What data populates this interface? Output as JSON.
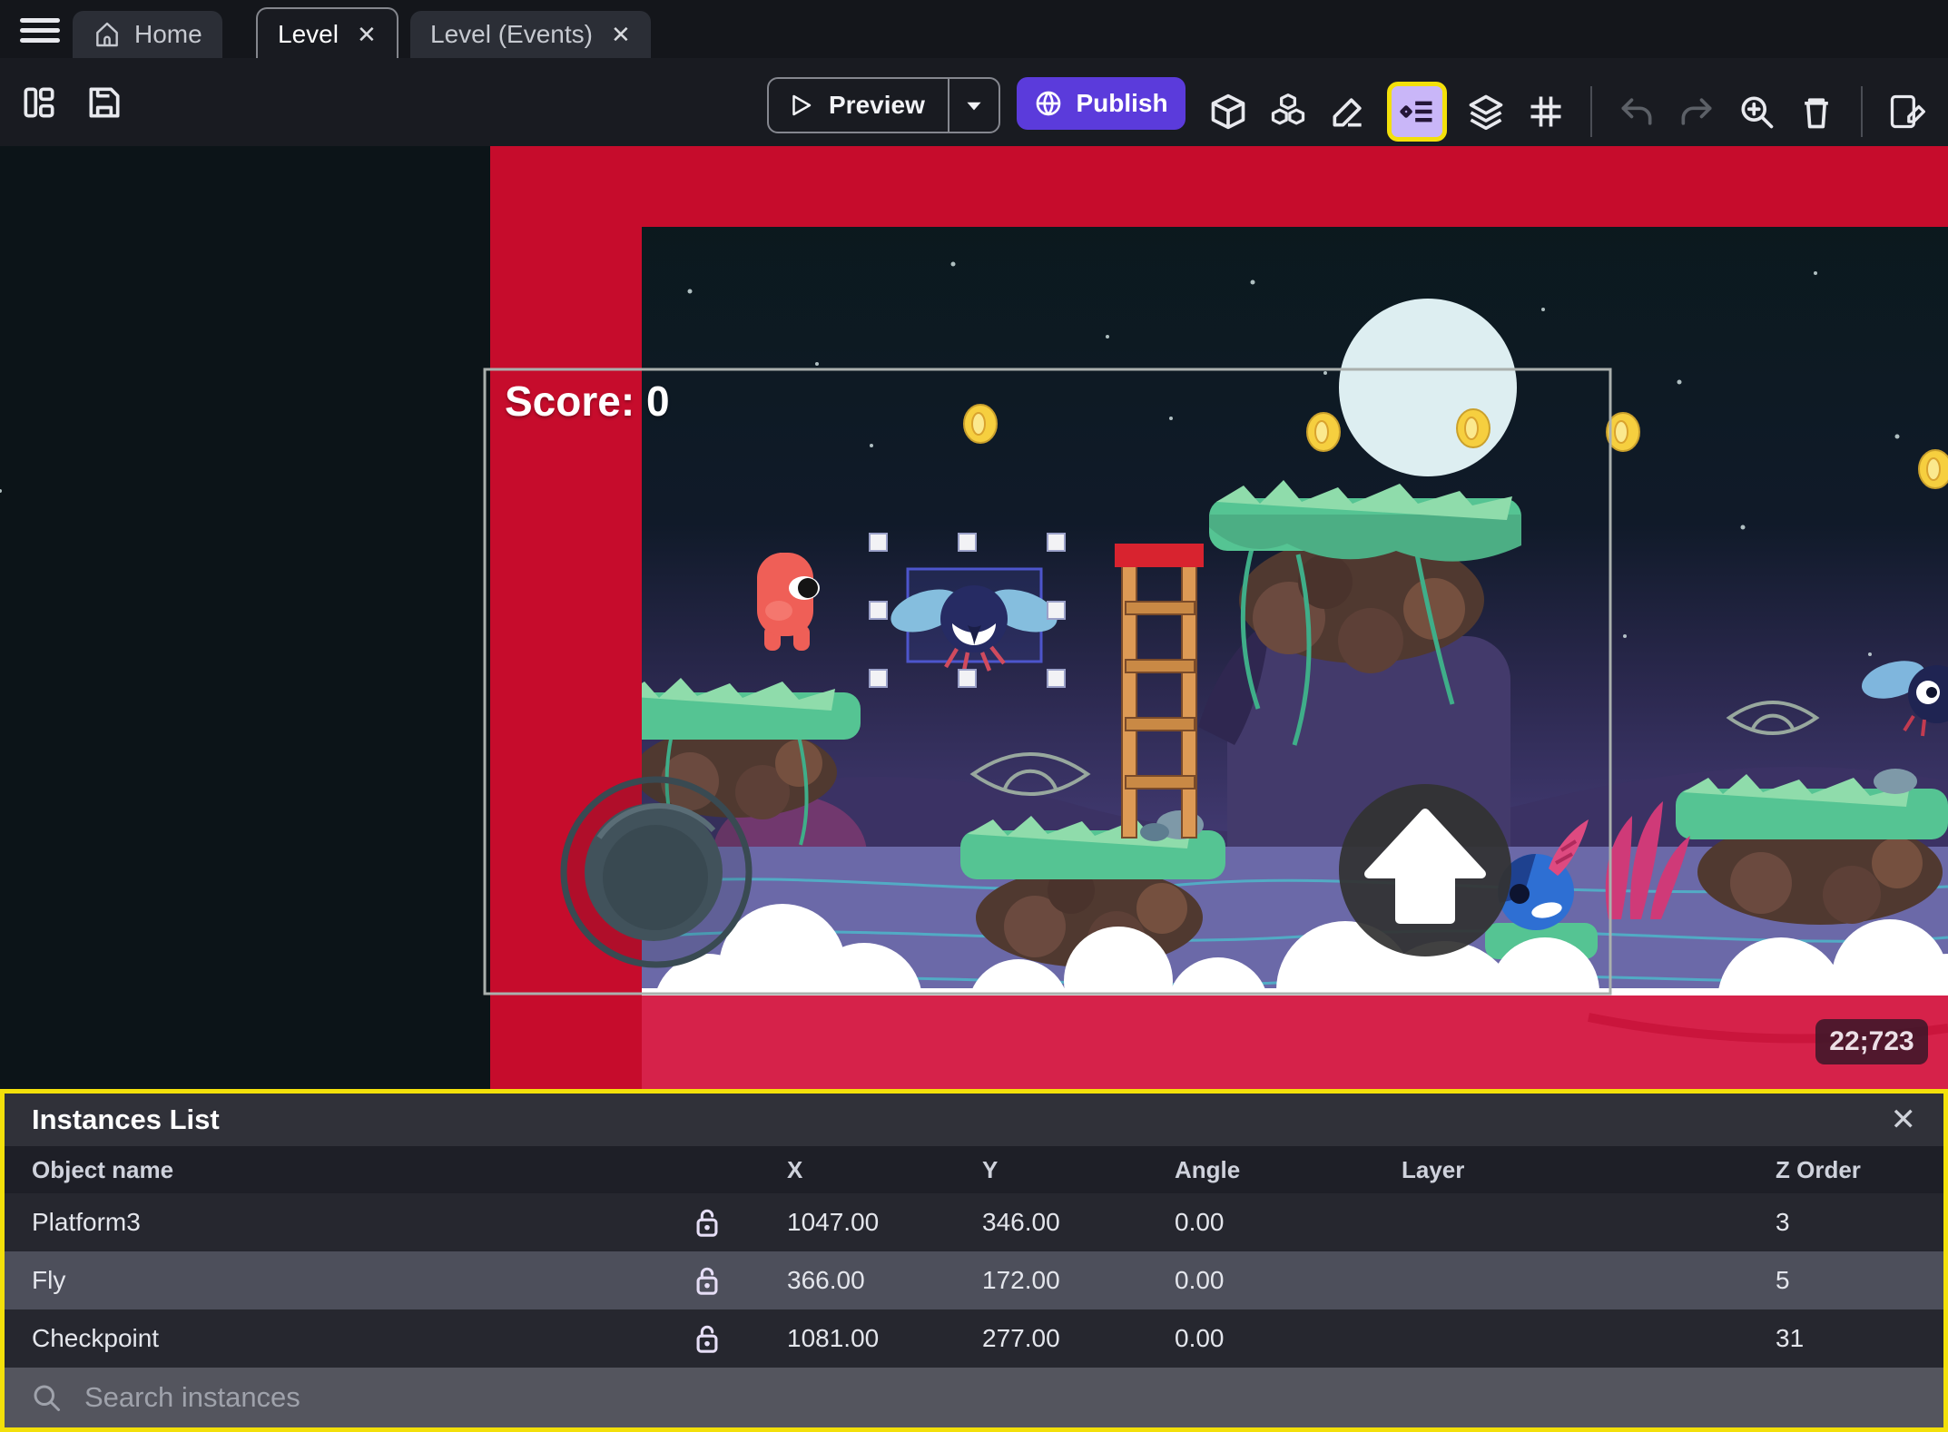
{
  "tabs": {
    "items": [
      {
        "label": "Home",
        "active": false,
        "closable": false
      },
      {
        "label": "Level",
        "active": true,
        "closable": true
      },
      {
        "label": "Level (Events)",
        "active": false,
        "closable": true
      }
    ],
    "close_glyph": "✕"
  },
  "toolbar": {
    "preview_label": "Preview",
    "publish_label": "Publish",
    "left_icons": [
      "project-manager",
      "save"
    ],
    "right_icons": [
      "objects-cube",
      "object-groups",
      "edit-pencil",
      "instances-list",
      "layers",
      "grid",
      "undo",
      "redo",
      "zoom-in",
      "delete",
      "edit-events"
    ],
    "highlighted_icon": "instances-list",
    "publish_color": "#5b3bdb",
    "highlight_color": "#f3e00a"
  },
  "canvas": {
    "score_label": "Score: 0",
    "position_badge": "22;723"
  },
  "instances": {
    "title": "Instances List",
    "close_glyph": "✕",
    "columns": [
      "Object name",
      "X",
      "Y",
      "Angle",
      "Layer",
      "Z Order"
    ],
    "rows": [
      {
        "name": "Platform3",
        "x": "1047.00",
        "y": "346.00",
        "angle": "0.00",
        "layer": "",
        "z_order": "3",
        "locked": false,
        "selected": false
      },
      {
        "name": "Fly",
        "x": "366.00",
        "y": "172.00",
        "angle": "0.00",
        "layer": "",
        "z_order": "5",
        "locked": false,
        "selected": true
      },
      {
        "name": "Checkpoint",
        "x": "1081.00",
        "y": "277.00",
        "angle": "0.00",
        "layer": "",
        "z_order": "31",
        "locked": false,
        "selected": false
      }
    ],
    "search_placeholder": "Search instances"
  },
  "colors": {
    "panel_highlight": "#f3e00a",
    "red_band": "#c60c2c",
    "bottom_band": "#d6224a",
    "selection": "#4d55cc",
    "selected_row": "#4d4f5b"
  }
}
